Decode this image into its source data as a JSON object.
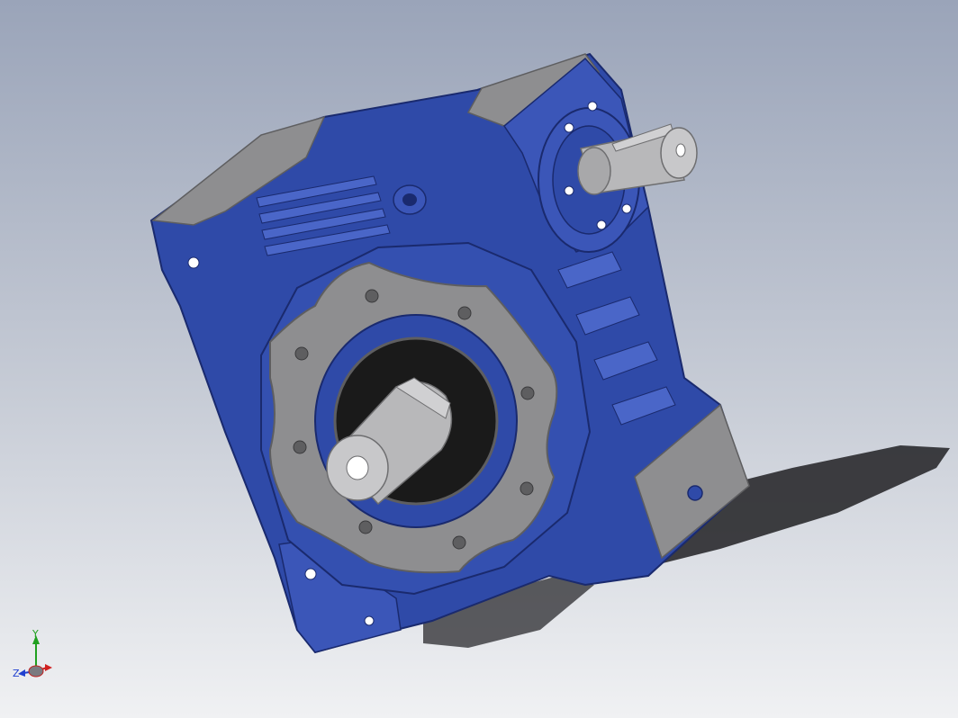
{
  "model": {
    "colors": {
      "housing": "#2f4aa8",
      "housing_dark": "#1a2a6e",
      "housing_light": "#4a66c8",
      "steel": "#8e8e90",
      "steel_dark": "#5e5e60",
      "shaft": "#b8b8ba",
      "seal": "#1a1a1a",
      "shadow": "#2a2a2e"
    }
  },
  "triad": {
    "x_label": "",
    "y_label": "Y",
    "z_label": "Z",
    "colors": {
      "x": "#d02020",
      "y": "#20a020",
      "z": "#2040d0"
    }
  }
}
